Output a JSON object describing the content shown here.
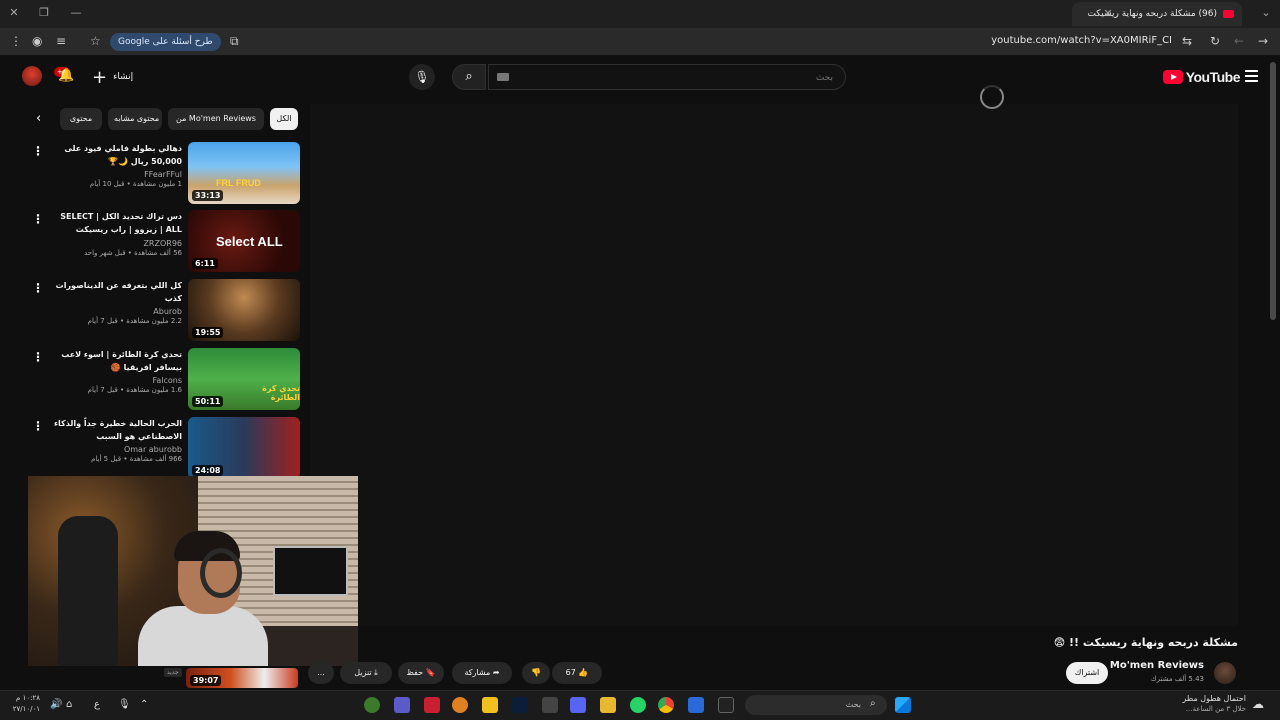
{
  "browser": {
    "tab_title": "(96) مشكلة دربحه ونهاية ريسيكت",
    "url": "youtube.com/watch?v=XA0MIRiF_CI",
    "google_chip": "طرح أسئلة على Google"
  },
  "header": {
    "logo_text": "YouTube",
    "search_placeholder": "بحث",
    "create_label": "إنشاء",
    "notifications_badge": "+9"
  },
  "chips": [
    "الكل",
    "من Mo'men Reviews",
    "محتوى مشابه",
    "محتوى"
  ],
  "recommendations": [
    {
      "title": "دهالي بطولة فاملي فيود على 50,000 ريال 🌙🏆",
      "channel": "FFearFFul",
      "stats": "1 مليون مشاهدة • قبل 10 أيام",
      "duration": "33:13",
      "thumb_text": "FRL FRUD"
    },
    {
      "title": "دس تراك تحديد الكل | SELECT ALL | زيزوو | راب ريسيكت (Official Video",
      "channel": "ZRZOR96",
      "stats": "56 ألف مشاهدة • قبل شهر واحد",
      "duration": "6:11",
      "thumb_text": "Select ALL"
    },
    {
      "title": "كل اللي بتعرفه عن الديناصورات كذب",
      "channel": "Aburob",
      "stats": "2.2 مليون مشاهدة • قبل 7 أيام",
      "duration": "19:55",
      "thumb_text": ""
    },
    {
      "title": "تحدي كرة الطائرة | اسوء لاعب بيسافر افريقيا 🏀",
      "channel": "Falcons",
      "stats": "1.6 مليون مشاهدة • قبل 7 أيام",
      "duration": "50:11",
      "thumb_text": "تحدي كرة الطائرة"
    },
    {
      "title": "الحرب الحالية خطيرة جداً والذكاء الاصطناعي هو السبب",
      "channel": "Omar aburobb",
      "stats": "966 ألف مشاهدة • قبل 5 أيام",
      "duration": "24:08",
      "thumb_text": ""
    }
  ],
  "video": {
    "title": "مشكلة دربحه ونهاية ريسيكت !! 😨",
    "channel_name": "Mo'men Reviews",
    "subscribers": "5.43 ألف مشترك",
    "subscribe_label": "اشتراك",
    "likes": "67",
    "share_label": "مشاركة",
    "save_label": "حفظ",
    "download_label": "تنزيل",
    "more_label": "...",
    "mini_duration": "39:07",
    "new_badge": "جديد"
  },
  "taskbar": {
    "search_placeholder": "بحث",
    "weather_title": "احتمال هطول مطر",
    "weather_sub": "خلال ٣ من الساعة...",
    "clock_time": "١٠:٢٨ م",
    "clock_date": "٢٧/١٠/٠١",
    "lang": "ع"
  }
}
